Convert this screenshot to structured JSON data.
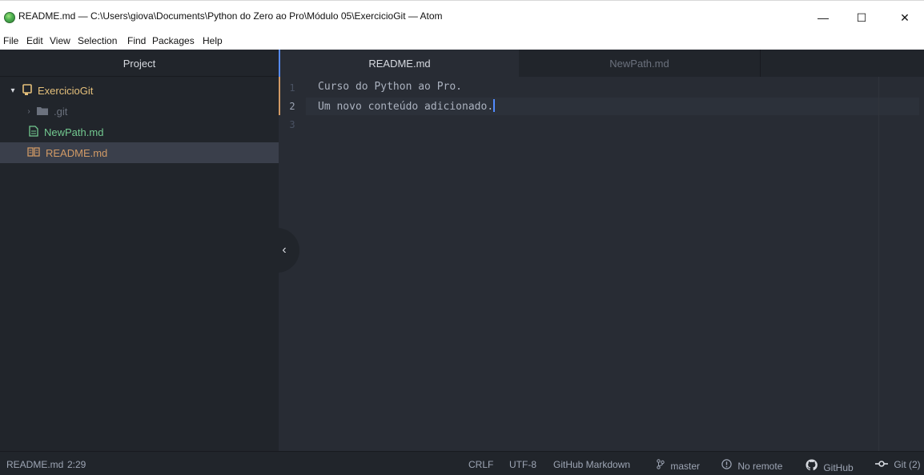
{
  "window": {
    "title": "README.md — C:\\Users\\giova\\Documents\\Python do Zero ao Pro\\Módulo 05\\ExercicioGit — Atom",
    "minimize": "—",
    "maximize": "☐",
    "close": "✕"
  },
  "menu": [
    "File",
    "Edit",
    "View",
    "Selection",
    "Find",
    "Packages",
    "Help"
  ],
  "tree": {
    "header": "Project",
    "root": "ExercicioGit",
    "items": [
      ".git",
      "NewPath.md",
      "README.md"
    ]
  },
  "tabs": [
    {
      "label": "README.md",
      "active": true
    },
    {
      "label": "NewPath.md",
      "active": false
    }
  ],
  "editor": {
    "line_numbers": [
      "1",
      "2",
      "3"
    ],
    "lines": [
      "Curso do Python ao Pro.",
      "Um novo conteúdo adicionado.",
      ""
    ]
  },
  "status": {
    "file": "README.md",
    "position": "2:29",
    "line_ending": "CRLF",
    "encoding": "UTF-8",
    "grammar": "GitHub Markdown",
    "branch": "master",
    "remote": "No remote",
    "github": "GitHub",
    "git": "Git (2)"
  },
  "colors": {
    "accent": "#568af2",
    "tree_root": "#e5c07b",
    "new_file": "#73c990",
    "modified": "#d19a66"
  }
}
